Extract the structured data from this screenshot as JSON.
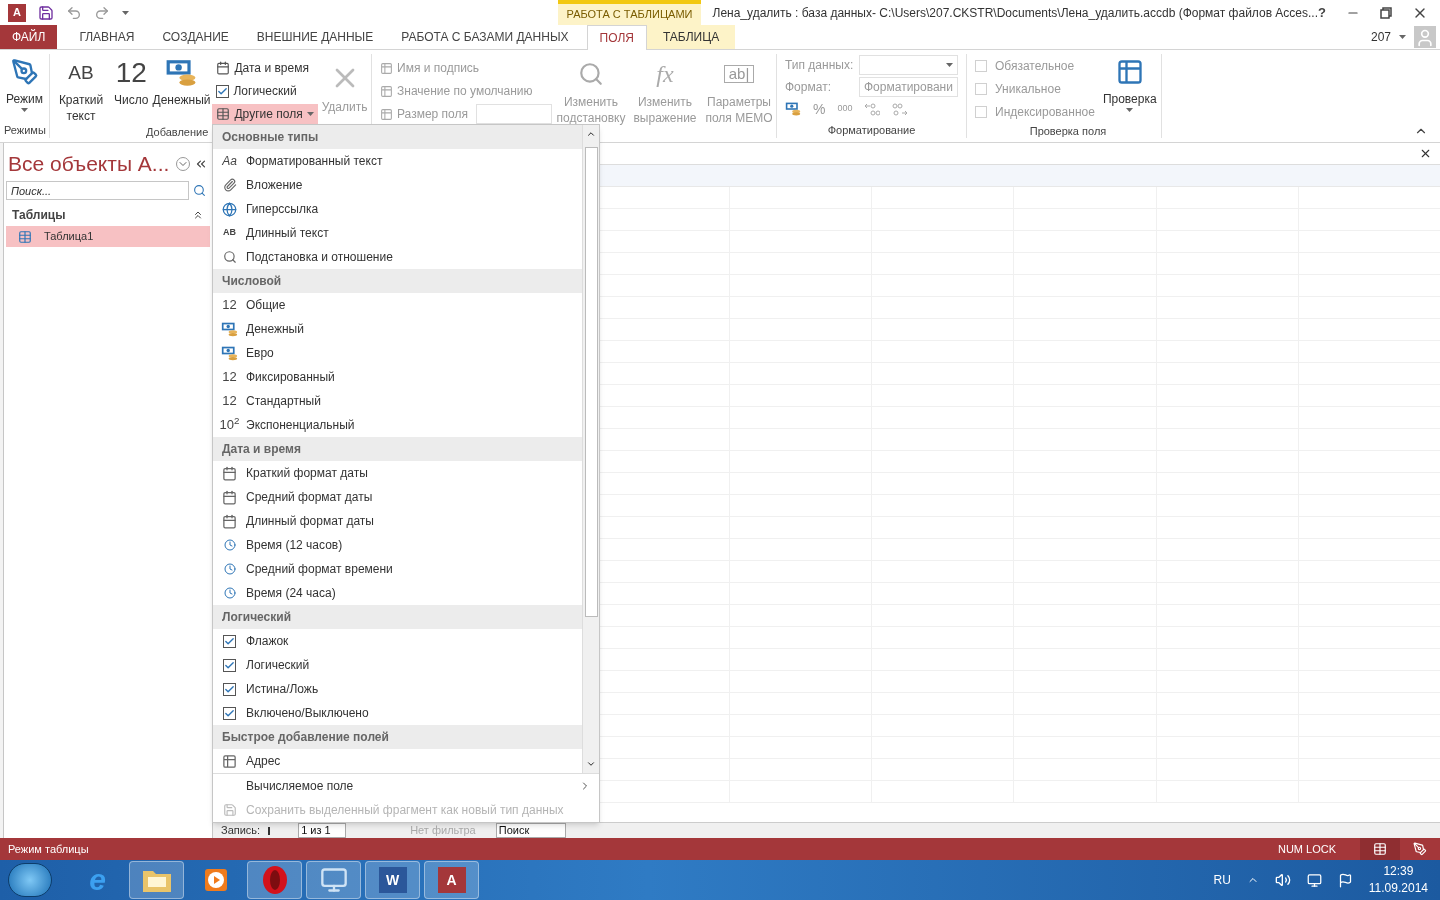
{
  "title_bar": {
    "app_logo_text": "A",
    "context_group": "РАБОТА С ТАБЛИЦАМИ",
    "title": "Лена_удалить : база данных- C:\\Users\\207.CKSTR\\Documents\\Лена_удалить.accdb (Формат файлов Acces...",
    "help": "?",
    "account": "207"
  },
  "tabs": [
    {
      "label": "ФАЙЛ",
      "kind": "file",
      "selected": false
    },
    {
      "label": "ГЛАВНАЯ",
      "kind": "normal",
      "selected": false
    },
    {
      "label": "СОЗДАНИЕ",
      "kind": "normal",
      "selected": false
    },
    {
      "label": "ВНЕШНИЕ ДАННЫЕ",
      "kind": "normal",
      "selected": false
    },
    {
      "label": "РАБОТА С БАЗАМИ ДАННЫХ",
      "kind": "normal",
      "selected": false
    },
    {
      "label": "ПОЛЯ",
      "kind": "context",
      "selected": true
    },
    {
      "label": "ТАБЛИЦА",
      "kind": "context",
      "selected": false
    }
  ],
  "ribbon": {
    "modes": {
      "button": "Режим",
      "group": "Режимы"
    },
    "add": {
      "large": [
        {
          "label": "Краткий текст",
          "icon_text": "AB",
          "kind": "text"
        },
        {
          "label": "Число",
          "icon_text": "12",
          "kind": "number"
        },
        {
          "label": "Денежный",
          "kind": "money"
        }
      ],
      "small": [
        {
          "label": "Дата и время",
          "kind": "date",
          "selected": false
        },
        {
          "label": "Логический",
          "kind": "check",
          "selected": false
        },
        {
          "label": "Другие поля",
          "kind": "more",
          "selected": true
        }
      ],
      "delete": {
        "label": "Удалить",
        "disabled": true
      },
      "group": "Добавление"
    },
    "properties": {
      "small": [
        {
          "label": "Имя и подпись",
          "disabled": true
        },
        {
          "label": "Значение по умолчанию",
          "disabled": true
        },
        {
          "label": "Размер поля",
          "disabled": true
        }
      ],
      "large": [
        {
          "label": "Изменить подстановку",
          "kind": "lookup",
          "disabled": true
        },
        {
          "label": "Изменить выражение",
          "kind": "fx",
          "icon_text": "fx",
          "disabled": true
        },
        {
          "label": "Параметры поля MEMO",
          "kind": "memo",
          "icon_text": "ab|",
          "disabled": true
        }
      ]
    },
    "formatting": {
      "data_type_label": "Тип данных:",
      "format_label": "Формат:",
      "format_value": "Форматировани",
      "percent": "%",
      "thousands": "000",
      "group": "Форматирование"
    },
    "validation": {
      "checks": [
        {
          "label": "Обязательное",
          "checked": false,
          "disabled": true
        },
        {
          "label": "Уникальное",
          "checked": false,
          "disabled": true
        },
        {
          "label": "Индексированное",
          "checked": false,
          "disabled": true
        }
      ],
      "button": "Проверка",
      "group": "Проверка поля"
    }
  },
  "nav_pane": {
    "title": "Все объекты A...",
    "search": {
      "placeholder": "Поиск..."
    },
    "section": "Таблицы",
    "items": [
      {
        "label": "Таблица1",
        "selected": true
      }
    ]
  },
  "menu": {
    "sections": [
      {
        "header": "Основные типы",
        "items": [
          {
            "label": "Форматированный текст",
            "kind": "italic",
            "icon_text": "Aa"
          },
          {
            "label": "Вложение",
            "kind": "clip"
          },
          {
            "label": "Гиперссылка",
            "kind": "globe"
          },
          {
            "label": "Длинный текст",
            "kind": "bold",
            "icon_text": "AB"
          },
          {
            "label": "Подстановка и отношение",
            "kind": "lookup"
          }
        ]
      },
      {
        "header": "Числовой",
        "items": [
          {
            "label": "Общие",
            "kind": "text",
            "icon_text": "12"
          },
          {
            "label": "Денежный",
            "kind": "money"
          },
          {
            "label": "Евро",
            "kind": "money"
          },
          {
            "label": "Фиксированный",
            "kind": "text",
            "icon_text": "12"
          },
          {
            "label": "Стандартный",
            "kind": "text",
            "icon_text": "12"
          },
          {
            "label": "Экспоненциальный",
            "kind": "text",
            "icon_text": "10$^{2}$"
          }
        ]
      },
      {
        "header": "Дата и время",
        "items": [
          {
            "label": "Краткий формат даты",
            "kind": "calendar"
          },
          {
            "label": "Средний формат даты",
            "kind": "calendar"
          },
          {
            "label": "Длинный формат даты",
            "kind": "calendar"
          },
          {
            "label": "Время (12 часов)",
            "kind": "clock"
          },
          {
            "label": "Средний формат времени",
            "kind": "clock"
          },
          {
            "label": "Время (24 часа)",
            "kind": "clock"
          }
        ]
      },
      {
        "header": "Логический",
        "items": [
          {
            "label": "Флажок",
            "kind": "check"
          },
          {
            "label": "Логический",
            "kind": "check"
          },
          {
            "label": "Истина/Ложь",
            "kind": "check"
          },
          {
            "label": "Включено/Выключено",
            "kind": "check"
          }
        ]
      },
      {
        "header": "Быстрое добавление полей",
        "items": [
          {
            "label": "Адрес",
            "kind": "address"
          }
        ]
      }
    ],
    "footer": [
      {
        "label": "Вычисляемое поле",
        "submenu": true,
        "disabled": false
      },
      {
        "label": "Сохранить выделенный фрагмент как новый тип данных",
        "submenu": false,
        "disabled": true
      }
    ]
  },
  "record_nav": {
    "label": "Запись:",
    "position": "1 из 1",
    "filter": "Нет фильтра",
    "search": "Поиск"
  },
  "status_bar": {
    "text": "Режим таблицы",
    "num_lock": "NUM LOCK"
  },
  "taskbar": {
    "apps": [
      {
        "kind": "ie",
        "logo_text": "e",
        "pinned": false
      },
      {
        "kind": "folder",
        "pinned": true
      },
      {
        "kind": "media",
        "pinned": false
      },
      {
        "kind": "opera",
        "pinned": true
      },
      {
        "kind": "remote",
        "pinned": true
      },
      {
        "kind": "word",
        "logo_text": "W",
        "pinned": true
      },
      {
        "kind": "access",
        "logo_text": "A",
        "pinned": true
      }
    ],
    "lang": "RU",
    "time": "12:39",
    "date": "11.09.2014"
  }
}
